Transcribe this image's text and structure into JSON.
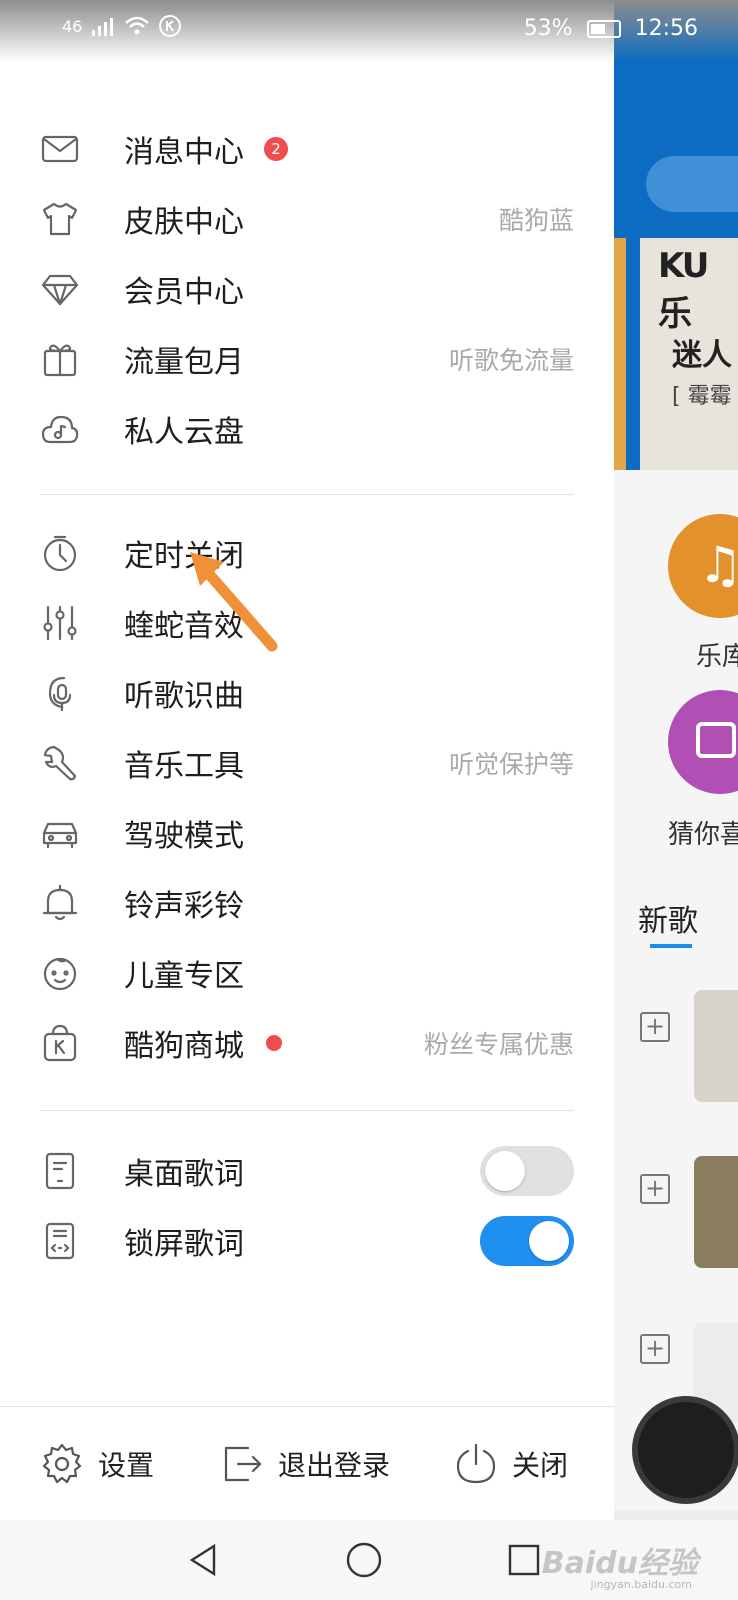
{
  "status_bar": {
    "network": "46",
    "battery": "53%",
    "time": "12:56"
  },
  "menu_group1": [
    {
      "label": "消息中心",
      "icon": "mail-icon",
      "badge": "2",
      "hint": ""
    },
    {
      "label": "皮肤中心",
      "icon": "tshirt-icon",
      "hint": "酷狗蓝"
    },
    {
      "label": "会员中心",
      "icon": "diamond-icon",
      "hint": ""
    },
    {
      "label": "流量包月",
      "icon": "gift-icon",
      "hint": "听歌免流量"
    },
    {
      "label": "私人云盘",
      "icon": "cloud-music-icon",
      "hint": ""
    }
  ],
  "menu_group2": [
    {
      "label": "定时关闭",
      "icon": "timer-icon",
      "hint": ""
    },
    {
      "label": "蝰蛇音效",
      "icon": "equalizer-icon",
      "hint": ""
    },
    {
      "label": "听歌识曲",
      "icon": "mic-recognition-icon",
      "hint": ""
    },
    {
      "label": "音乐工具",
      "icon": "wrench-icon",
      "hint": "听觉保护等"
    },
    {
      "label": "驾驶模式",
      "icon": "car-icon",
      "hint": ""
    },
    {
      "label": "铃声彩铃",
      "icon": "bell-icon",
      "hint": ""
    },
    {
      "label": "儿童专区",
      "icon": "baby-face-icon",
      "hint": ""
    },
    {
      "label": "酷狗商城",
      "icon": "shop-bag-icon",
      "dot": true,
      "hint": "粉丝专属优惠"
    }
  ],
  "toggles": [
    {
      "label": "桌面歌词",
      "icon": "desktop-lyrics-icon",
      "state": "off"
    },
    {
      "label": "锁屏歌词",
      "icon": "lock-lyrics-icon",
      "state": "on"
    }
  ],
  "bottom_bar": {
    "settings": "设置",
    "logout": "退出登录",
    "close": "关闭"
  },
  "background_app": {
    "banner_title": "KU乐",
    "banner_line": "迷人",
    "banner_sub": "[ 霉霉",
    "cat1": "乐库",
    "cat2": "猜你喜",
    "tab": "新歌"
  },
  "watermark": {
    "text": "Baidu经验",
    "sub": "jingyan.baidu.com"
  },
  "colors": {
    "accent_blue": "#1f8ff0",
    "badge_red": "#ef4d4d",
    "annotation_arrow": "#f0913a",
    "header_blue": "#0d6cc2"
  }
}
